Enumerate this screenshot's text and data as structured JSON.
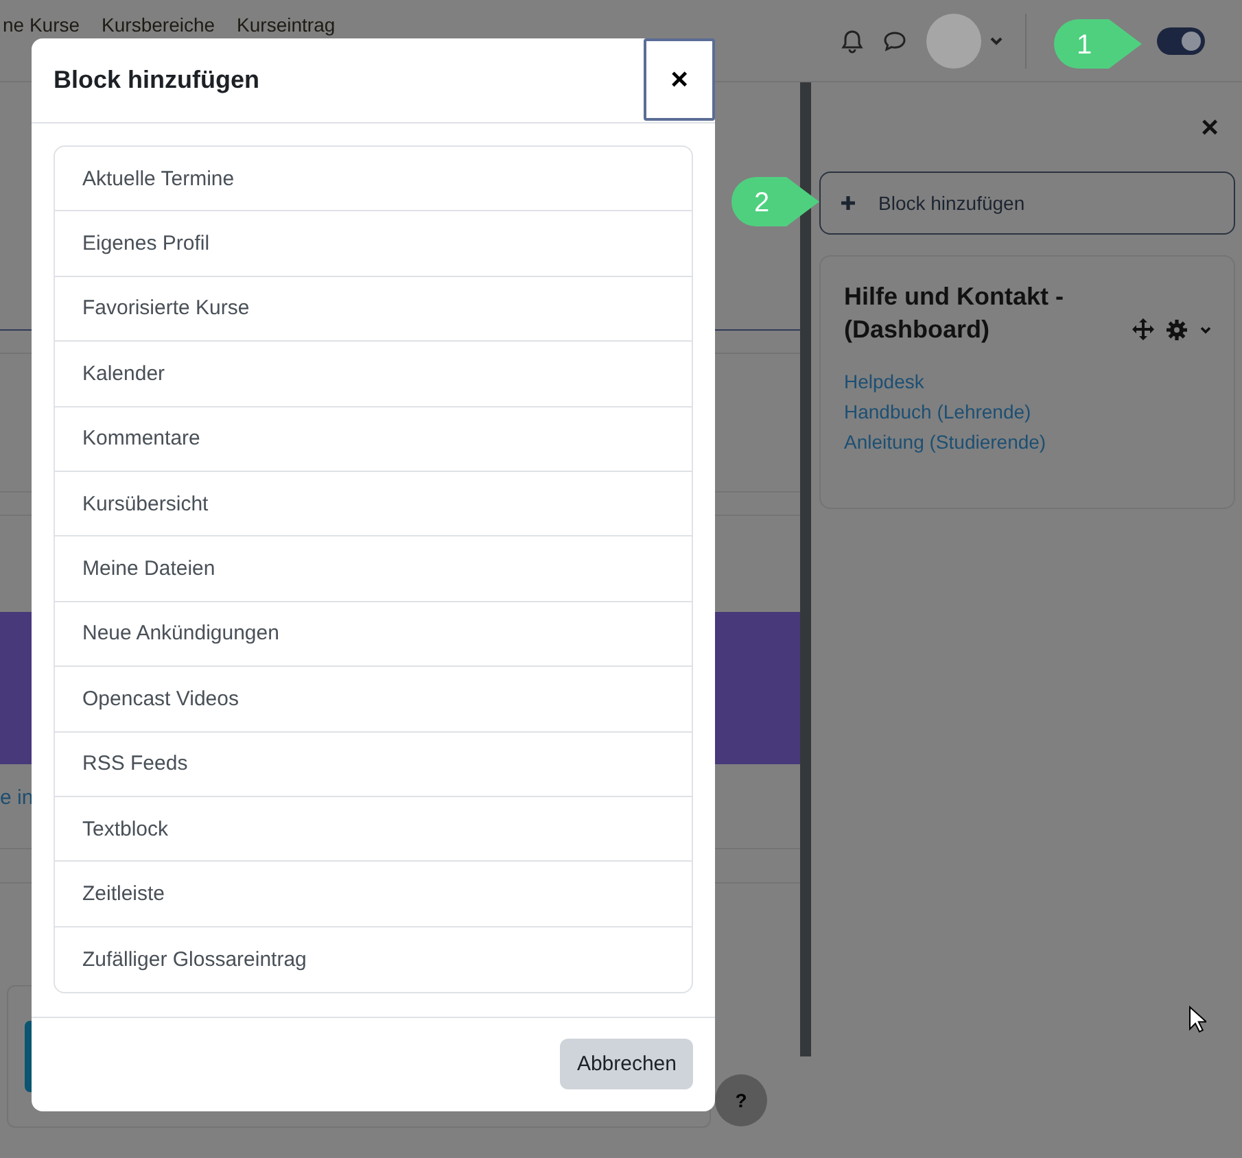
{
  "breadcrumb": [
    "ne Kurse",
    "Kursbereiche",
    "Kurseintrag"
  ],
  "topbar": {
    "edit_mode": {
      "on": true
    }
  },
  "background": {
    "link": "e in"
  },
  "drawer": {
    "close": "×",
    "add_block_button": "Block hinzufügen",
    "block": {
      "title": "Hilfe und Kontakt - (Dashboard)",
      "links": [
        "Helpdesk",
        "Handbuch (Lehrende)",
        "Anleitung (Studierende)"
      ]
    }
  },
  "modal": {
    "title": "Block hinzufügen",
    "close": "×",
    "items": [
      "Aktuelle Termine",
      "Eigenes Profil",
      "Favorisierte Kurse",
      "Kalender",
      "Kommentare",
      "Kursübersicht",
      "Meine Dateien",
      "Neue Ankündigungen",
      "Opencast Videos",
      "RSS Feeds",
      "Textblock",
      "Zeitleiste",
      "Zufälliger Glossareintrag"
    ],
    "cancel": "Abbrechen"
  },
  "help_button": "?",
  "callouts": [
    {
      "number": "1"
    },
    {
      "number": "2"
    }
  ]
}
